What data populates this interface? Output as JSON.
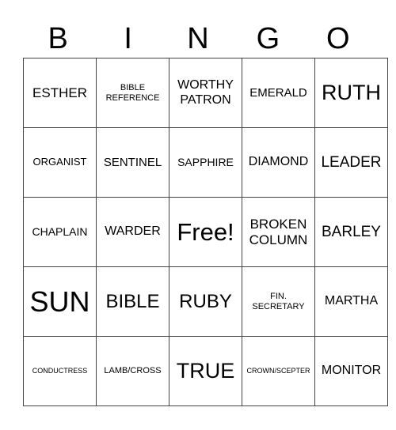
{
  "header": [
    "B",
    "I",
    "N",
    "G",
    "O"
  ],
  "rows": [
    [
      "ESTHER",
      "BIBLE REFERENCE",
      "WORTHY PATRON",
      "EMERALD",
      "RUTH"
    ],
    [
      "ORGANIST",
      "SENTINEL",
      "SAPPHIRE",
      "DIAMOND",
      "LEADER"
    ],
    [
      "CHAPLAIN",
      "WARDER",
      "Free!",
      "BROKEN COLUMN",
      "BARLEY"
    ],
    [
      "SUN",
      "BIBLE",
      "RUBY",
      "FIN. SECRETARY",
      "MARTHA"
    ],
    [
      "CONDUCTRESS",
      "LAMB/CROSS",
      "TRUE",
      "CROWN/SCEPTER",
      "MONITOR"
    ]
  ]
}
